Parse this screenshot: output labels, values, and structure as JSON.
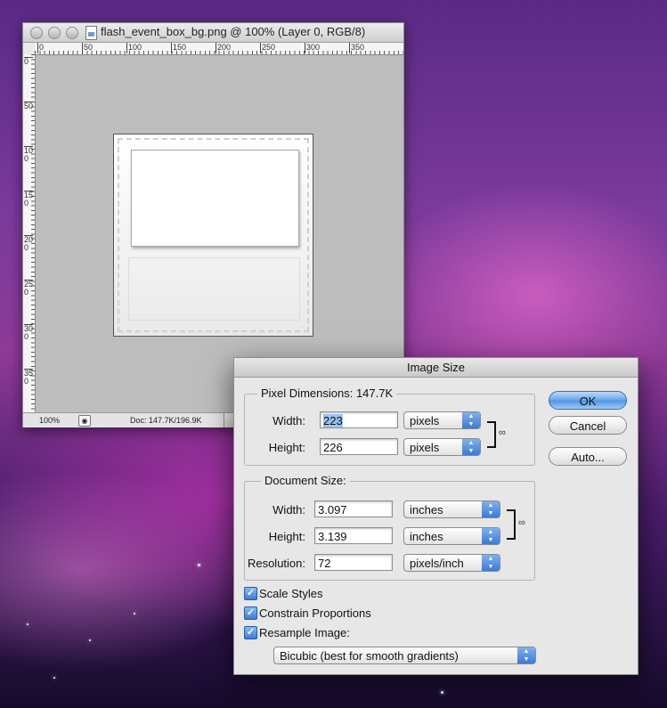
{
  "document_window": {
    "title": "flash_event_box_bg.png @ 100% (Layer 0, RGB/8)",
    "ruler_top_labels": [
      "0",
      "50",
      "100",
      "150",
      "200",
      "250",
      "300",
      "350"
    ],
    "ruler_left_labels": [
      "0",
      "50",
      "100",
      "150",
      "200",
      "250",
      "300",
      "350"
    ],
    "status": {
      "zoom": "100%",
      "doc_size": "Doc: 147.7K/196.9K"
    }
  },
  "dialog": {
    "title": "Image Size",
    "pixel_dimensions": {
      "label": "Pixel Dimensions:",
      "size": "147.7K",
      "width_label": "Width:",
      "width_value": "223",
      "width_unit": "pixels",
      "height_label": "Height:",
      "height_value": "226",
      "height_unit": "pixels"
    },
    "document_size": {
      "label": "Document Size:",
      "width_label": "Width:",
      "width_value": "3.097",
      "width_unit": "inches",
      "height_label": "Height:",
      "height_value": "3.139",
      "height_unit": "inches",
      "resolution_label": "Resolution:",
      "resolution_value": "72",
      "resolution_unit": "pixels/inch"
    },
    "checkboxes": {
      "scale_styles": "Scale Styles",
      "constrain_proportions": "Constrain Proportions",
      "resample_image": "Resample Image:"
    },
    "resample_method": "Bicubic (best for smooth gradients)",
    "buttons": {
      "ok": "OK",
      "cancel": "Cancel",
      "auto": "Auto..."
    }
  }
}
